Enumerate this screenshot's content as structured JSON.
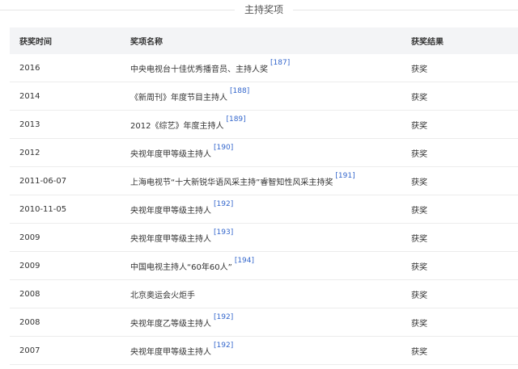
{
  "section": {
    "title": "主持奖项"
  },
  "table": {
    "headers": {
      "date": "获奖时间",
      "name": "奖项名称",
      "result": "获奖结果"
    },
    "rows": [
      {
        "date": "2016",
        "name": "中央电视台十佳优秀播音员、主持人奖",
        "cite": "[187]",
        "result": "获奖"
      },
      {
        "date": "2014",
        "name": "《新周刊》年度节目主持人",
        "cite": "[188]",
        "result": "获奖"
      },
      {
        "date": "2013",
        "name": "2012《综艺》年度主持人",
        "cite": "[189]",
        "result": "获奖"
      },
      {
        "date": "2012",
        "name": "央视年度甲等级主持人",
        "cite": "[190]",
        "result": "获奖"
      },
      {
        "date": "2011-06-07",
        "name": "上海电视节“十大新锐华语风采主持”睿智知性风采主持奖",
        "cite": "[191]",
        "result": "获奖"
      },
      {
        "date": "2010-11-05",
        "name": "央视年度甲等级主持人",
        "cite": "[192]",
        "result": "获奖"
      },
      {
        "date": "2009",
        "name": "央视年度甲等级主持人",
        "cite": "[193]",
        "result": "获奖"
      },
      {
        "date": "2009",
        "name": "中国电视主持人“60年60人”",
        "cite": "[194]",
        "result": "获奖"
      },
      {
        "date": "2008",
        "name": "北京奥运会火炬手",
        "cite": "",
        "result": "获奖"
      },
      {
        "date": "2008",
        "name": "央视年度乙等级主持人",
        "cite": "[192]",
        "result": "获奖"
      },
      {
        "date": "2007",
        "name": "央视年度甲等级主持人",
        "cite": "[192]",
        "result": "获奖"
      }
    ]
  }
}
